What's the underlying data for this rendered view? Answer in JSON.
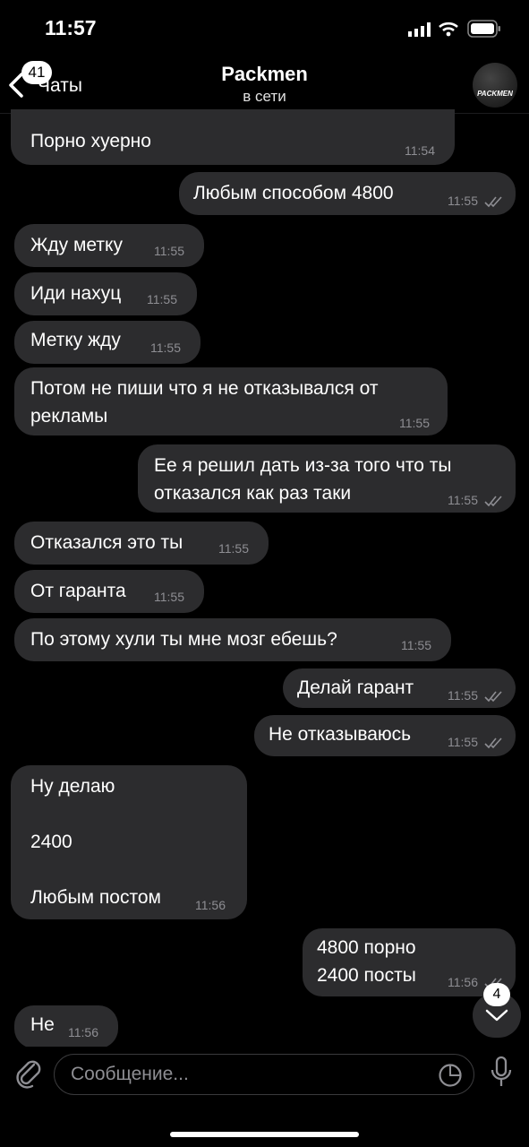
{
  "status_bar": {
    "time": "11:57"
  },
  "header": {
    "back_badge": "41",
    "back_label": "Чаты",
    "title": "Packmen",
    "subtitle": "в сети",
    "avatar_text": "PACKMEN"
  },
  "messages": [
    {
      "dir": "in",
      "text": "Порно хуерно",
      "time": "11:54"
    },
    {
      "dir": "out",
      "text": "Любым способом 4800",
      "time": "11:55",
      "read": true
    },
    {
      "dir": "in",
      "text": "Жду метку",
      "time": "11:55"
    },
    {
      "dir": "in",
      "text": "Иди нахуц",
      "time": "11:55"
    },
    {
      "dir": "in",
      "text": "Метку жду",
      "time": "11:55"
    },
    {
      "dir": "in",
      "text": "Потом не пиши что я не отказывался от\nрекламы",
      "time": "11:55"
    },
    {
      "dir": "out",
      "text": "Ее я решил дать из-за того что ты\nотказался как раз таки",
      "time": "11:55",
      "read": true
    },
    {
      "dir": "in",
      "text": "Отказался это ты",
      "time": "11:55"
    },
    {
      "dir": "in",
      "text": "От гаранта",
      "time": "11:55"
    },
    {
      "dir": "in",
      "text": "По этому хули ты мне мозг ебешь?",
      "time": "11:55"
    },
    {
      "dir": "out",
      "text": "Делай гарант",
      "time": "11:55",
      "read": true
    },
    {
      "dir": "out",
      "text": "Не отказываюсь",
      "time": "11:55",
      "read": true
    },
    {
      "dir": "in",
      "text": "Ну делаю\n\n2400\n\nЛюбым постом",
      "time": "11:56"
    },
    {
      "dir": "out",
      "text": "4800 порно\n2400 посты",
      "time": "11:56",
      "read": true
    },
    {
      "dir": "in",
      "text": "Не",
      "time": "11:56"
    }
  ],
  "scroll_down": {
    "badge": "4"
  },
  "composer": {
    "placeholder": "Сообщение..."
  },
  "colors": {
    "bubble": "#2c2c2e",
    "background": "#000000",
    "timestamp": "#8e8e93"
  },
  "icons": [
    "back-chevron-icon",
    "attach-icon",
    "sticker-icon",
    "mic-icon",
    "chevron-down-icon",
    "signal-icon",
    "wifi-icon",
    "battery-icon"
  ]
}
